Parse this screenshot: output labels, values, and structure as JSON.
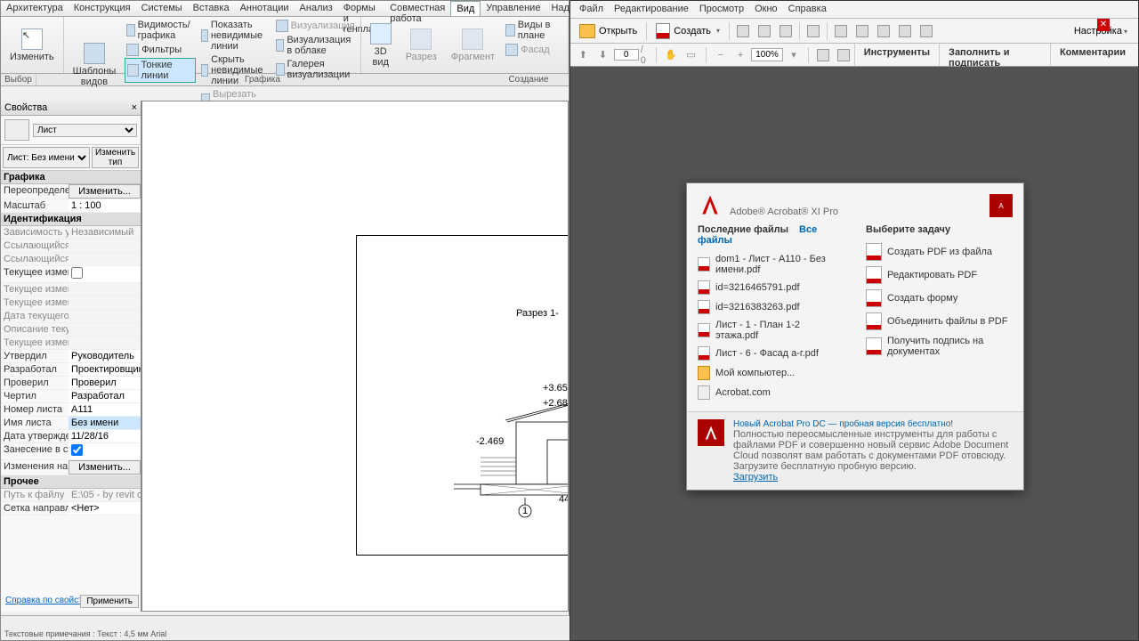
{
  "revit": {
    "tabs": [
      "Архитектура",
      "Конструкция",
      "Системы",
      "Вставка",
      "Аннотации",
      "Анализ",
      "Формы и генплан",
      "Совместная работа",
      "Вид",
      "Управление",
      "Надстройки"
    ],
    "active_tab": "Вид",
    "selector_label": "Выбор",
    "ribbon": {
      "modify": "Изменить",
      "templates": "Шаблоны\nвидов",
      "visibility": "Видимость/ графика",
      "filters": "Фильтры",
      "thin_lines": "Тонкие линии",
      "show_hidden": "Показать невидимые линии",
      "hide_hidden": "Скрыть невидимые линии",
      "cut_profile": "Вырезать профиль",
      "visualize": "Визуализация",
      "viz_cloud": "Визуализация в облаке",
      "viz_gallery": "Галерея визуализации",
      "view3d": "3D\nвид",
      "section": "Разрез",
      "fragment": "Фрагмент",
      "plan_views": "Виды в плане",
      "elevation": "Фасад",
      "graphics_label": "Графика",
      "create_label": "Создание"
    },
    "props": {
      "title": "Свойства",
      "sheet": "Лист",
      "filter": "Лист: Без имени",
      "change_type": "Изменить тип",
      "categories": {
        "graphics": "Графика",
        "ident": "Идентификация",
        "other": "Прочее"
      },
      "rows": [
        {
          "k": "Переопределени...",
          "v": "Изменить...",
          "btn": true
        },
        {
          "k": "Масштаб",
          "v": "1 : 100"
        },
        {
          "k": "Зависимость уро...",
          "v": "Независимый",
          "dis": true
        },
        {
          "k": "Ссылающийся л...",
          "v": "",
          "dis": true
        },
        {
          "k": "Ссылающийся у...",
          "v": "",
          "dis": true
        },
        {
          "k": "Текущее измене...",
          "v": "",
          "cb": true
        },
        {
          "k": "Текущее измене...",
          "v": "",
          "dis": true
        },
        {
          "k": "Текущее измене...",
          "v": "",
          "dis": true
        },
        {
          "k": "Дата текущего из...",
          "v": "",
          "dis": true
        },
        {
          "k": "Описание текущ...",
          "v": "",
          "dis": true
        },
        {
          "k": "Текущее измене...",
          "v": "",
          "dis": true
        },
        {
          "k": "Утвердил",
          "v": "Руководитель"
        },
        {
          "k": "Разработал",
          "v": "Проектировщик"
        },
        {
          "k": "Проверил",
          "v": "Проверил"
        },
        {
          "k": "Чертил",
          "v": "Разработал"
        },
        {
          "k": "Номер листа",
          "v": "A111"
        },
        {
          "k": "Имя листа",
          "v": "Без имени",
          "hl": true
        },
        {
          "k": "Дата утверждени...",
          "v": "11/28/16"
        },
        {
          "k": "Занесение в спи...",
          "v": "",
          "cb": true,
          "checked": true
        },
        {
          "k": "Изменения на ли...",
          "v": "Изменить...",
          "btn": true
        },
        {
          "k": "Путь к файлу",
          "v": "E:\\05 - by revit cou...",
          "dis": true
        },
        {
          "k": "Сетка направля...",
          "v": "<Нет>"
        }
      ],
      "help_link": "Справка по свойствам",
      "apply": "Применить"
    },
    "section_title": "Разрез 1-",
    "status": "Текстовые примечания : Текст : 4,5 мм Arial"
  },
  "acrobat": {
    "menu": [
      "Файл",
      "Редактирование",
      "Просмотр",
      "Окно",
      "Справка"
    ],
    "open": "Открыть",
    "create": "Создать",
    "settings": "Настройка",
    "page_current": "0",
    "page_total": "/ 0",
    "zoom": "100%",
    "panes": [
      "Инструменты",
      "Заполнить и подписать",
      "Комментарии"
    ],
    "welcome": {
      "title": "Adobe® Acrobat® XI Pro",
      "recent": "Последние файлы",
      "all": "Все файлы",
      "task": "Выберите задачу",
      "files": [
        "dom1 - Лист - A110 - Без имени.pdf",
        "id=3216465791.pdf",
        "id=3216383263.pdf",
        "Лист - 1 - План 1-2 этажа.pdf",
        "Лист - 6 - Фасад a-г.pdf",
        "Мой компьютер...",
        "Acrobat.com"
      ],
      "tasks": [
        "Создать PDF из файла",
        "Редактировать PDF",
        "Создать форму",
        "Объединить файлы в PDF",
        "Получить подпись на документах"
      ],
      "promo_title": "Новый Acrobat Pro DC — пробная версия бесплатно!",
      "promo_text": "Полностью переосмысленные инструменты для работы с файлами PDF и совершенно новый сервис Adobe Document Cloud позволят вам работать с документами PDF отовсюду. Загрузите бесплатную пробную версию.",
      "promo_link": "Загрузить"
    }
  }
}
